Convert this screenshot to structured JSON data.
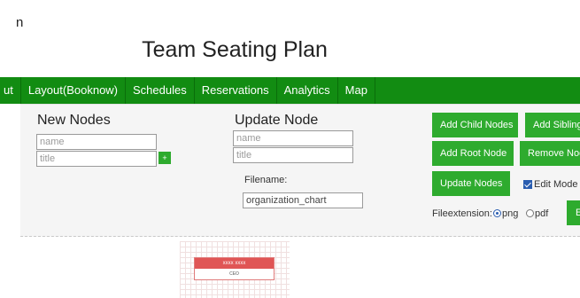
{
  "header": {
    "corner_text": "n",
    "page_title": "Team Seating Plan"
  },
  "nav": {
    "items": [
      "ut",
      "Layout(Booknow)",
      "Schedules",
      "Reservations",
      "Analytics",
      "Map"
    ]
  },
  "new_nodes": {
    "title": "New Nodes",
    "name_placeholder": "name",
    "title_placeholder": "title",
    "add_button": "+"
  },
  "update_node": {
    "title": "Update Node",
    "name_placeholder": "name",
    "title_placeholder": "title",
    "filename_label": "Filename:",
    "filename_value": "organization_chart"
  },
  "actions": {
    "add_child_nodes": "Add Child Nodes",
    "add_siblings": "Add Siblings",
    "add_root_node": "Add Root Node",
    "remove_nodes": "Remove Nodes",
    "update_nodes": "Update Nodes",
    "edit_mode_label": "Edit Mode",
    "edit_mode_checked": true,
    "export": "E"
  },
  "file_extension": {
    "label": "Fileextension:",
    "options": [
      "png",
      "pdf"
    ],
    "selected": "png"
  },
  "chart": {
    "node": {
      "name": "xxxx xxxx",
      "title": "CEO"
    }
  },
  "colors": {
    "nav_bg": "#128c12",
    "button_bg": "#2eab2e",
    "node_header": "#e05555"
  }
}
